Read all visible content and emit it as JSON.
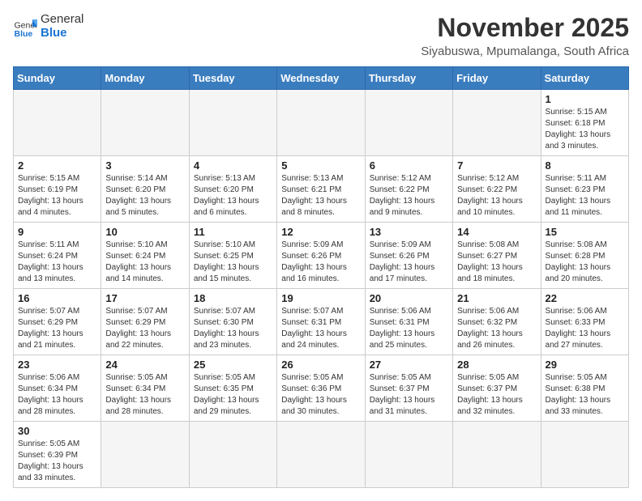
{
  "header": {
    "logo_text_general": "General",
    "logo_text_blue": "Blue",
    "title": "November 2025",
    "subtitle": "Siyabuswa, Mpumalanga, South Africa"
  },
  "weekdays": [
    "Sunday",
    "Monday",
    "Tuesday",
    "Wednesday",
    "Thursday",
    "Friday",
    "Saturday"
  ],
  "weeks": [
    [
      {
        "day": "",
        "info": ""
      },
      {
        "day": "",
        "info": ""
      },
      {
        "day": "",
        "info": ""
      },
      {
        "day": "",
        "info": ""
      },
      {
        "day": "",
        "info": ""
      },
      {
        "day": "",
        "info": ""
      },
      {
        "day": "1",
        "info": "Sunrise: 5:15 AM\nSunset: 6:18 PM\nDaylight: 13 hours\nand 3 minutes."
      }
    ],
    [
      {
        "day": "2",
        "info": "Sunrise: 5:15 AM\nSunset: 6:19 PM\nDaylight: 13 hours\nand 4 minutes."
      },
      {
        "day": "3",
        "info": "Sunrise: 5:14 AM\nSunset: 6:20 PM\nDaylight: 13 hours\nand 5 minutes."
      },
      {
        "day": "4",
        "info": "Sunrise: 5:13 AM\nSunset: 6:20 PM\nDaylight: 13 hours\nand 6 minutes."
      },
      {
        "day": "5",
        "info": "Sunrise: 5:13 AM\nSunset: 6:21 PM\nDaylight: 13 hours\nand 8 minutes."
      },
      {
        "day": "6",
        "info": "Sunrise: 5:12 AM\nSunset: 6:22 PM\nDaylight: 13 hours\nand 9 minutes."
      },
      {
        "day": "7",
        "info": "Sunrise: 5:12 AM\nSunset: 6:22 PM\nDaylight: 13 hours\nand 10 minutes."
      },
      {
        "day": "8",
        "info": "Sunrise: 5:11 AM\nSunset: 6:23 PM\nDaylight: 13 hours\nand 11 minutes."
      }
    ],
    [
      {
        "day": "9",
        "info": "Sunrise: 5:11 AM\nSunset: 6:24 PM\nDaylight: 13 hours\nand 13 minutes."
      },
      {
        "day": "10",
        "info": "Sunrise: 5:10 AM\nSunset: 6:24 PM\nDaylight: 13 hours\nand 14 minutes."
      },
      {
        "day": "11",
        "info": "Sunrise: 5:10 AM\nSunset: 6:25 PM\nDaylight: 13 hours\nand 15 minutes."
      },
      {
        "day": "12",
        "info": "Sunrise: 5:09 AM\nSunset: 6:26 PM\nDaylight: 13 hours\nand 16 minutes."
      },
      {
        "day": "13",
        "info": "Sunrise: 5:09 AM\nSunset: 6:26 PM\nDaylight: 13 hours\nand 17 minutes."
      },
      {
        "day": "14",
        "info": "Sunrise: 5:08 AM\nSunset: 6:27 PM\nDaylight: 13 hours\nand 18 minutes."
      },
      {
        "day": "15",
        "info": "Sunrise: 5:08 AM\nSunset: 6:28 PM\nDaylight: 13 hours\nand 20 minutes."
      }
    ],
    [
      {
        "day": "16",
        "info": "Sunrise: 5:07 AM\nSunset: 6:29 PM\nDaylight: 13 hours\nand 21 minutes."
      },
      {
        "day": "17",
        "info": "Sunrise: 5:07 AM\nSunset: 6:29 PM\nDaylight: 13 hours\nand 22 minutes."
      },
      {
        "day": "18",
        "info": "Sunrise: 5:07 AM\nSunset: 6:30 PM\nDaylight: 13 hours\nand 23 minutes."
      },
      {
        "day": "19",
        "info": "Sunrise: 5:07 AM\nSunset: 6:31 PM\nDaylight: 13 hours\nand 24 minutes."
      },
      {
        "day": "20",
        "info": "Sunrise: 5:06 AM\nSunset: 6:31 PM\nDaylight: 13 hours\nand 25 minutes."
      },
      {
        "day": "21",
        "info": "Sunrise: 5:06 AM\nSunset: 6:32 PM\nDaylight: 13 hours\nand 26 minutes."
      },
      {
        "day": "22",
        "info": "Sunrise: 5:06 AM\nSunset: 6:33 PM\nDaylight: 13 hours\nand 27 minutes."
      }
    ],
    [
      {
        "day": "23",
        "info": "Sunrise: 5:06 AM\nSunset: 6:34 PM\nDaylight: 13 hours\nand 28 minutes."
      },
      {
        "day": "24",
        "info": "Sunrise: 5:05 AM\nSunset: 6:34 PM\nDaylight: 13 hours\nand 28 minutes."
      },
      {
        "day": "25",
        "info": "Sunrise: 5:05 AM\nSunset: 6:35 PM\nDaylight: 13 hours\nand 29 minutes."
      },
      {
        "day": "26",
        "info": "Sunrise: 5:05 AM\nSunset: 6:36 PM\nDaylight: 13 hours\nand 30 minutes."
      },
      {
        "day": "27",
        "info": "Sunrise: 5:05 AM\nSunset: 6:37 PM\nDaylight: 13 hours\nand 31 minutes."
      },
      {
        "day": "28",
        "info": "Sunrise: 5:05 AM\nSunset: 6:37 PM\nDaylight: 13 hours\nand 32 minutes."
      },
      {
        "day": "29",
        "info": "Sunrise: 5:05 AM\nSunset: 6:38 PM\nDaylight: 13 hours\nand 33 minutes."
      }
    ],
    [
      {
        "day": "30",
        "info": "Sunrise: 5:05 AM\nSunset: 6:39 PM\nDaylight: 13 hours\nand 33 minutes."
      },
      {
        "day": "",
        "info": ""
      },
      {
        "day": "",
        "info": ""
      },
      {
        "day": "",
        "info": ""
      },
      {
        "day": "",
        "info": ""
      },
      {
        "day": "",
        "info": ""
      },
      {
        "day": "",
        "info": ""
      }
    ]
  ]
}
